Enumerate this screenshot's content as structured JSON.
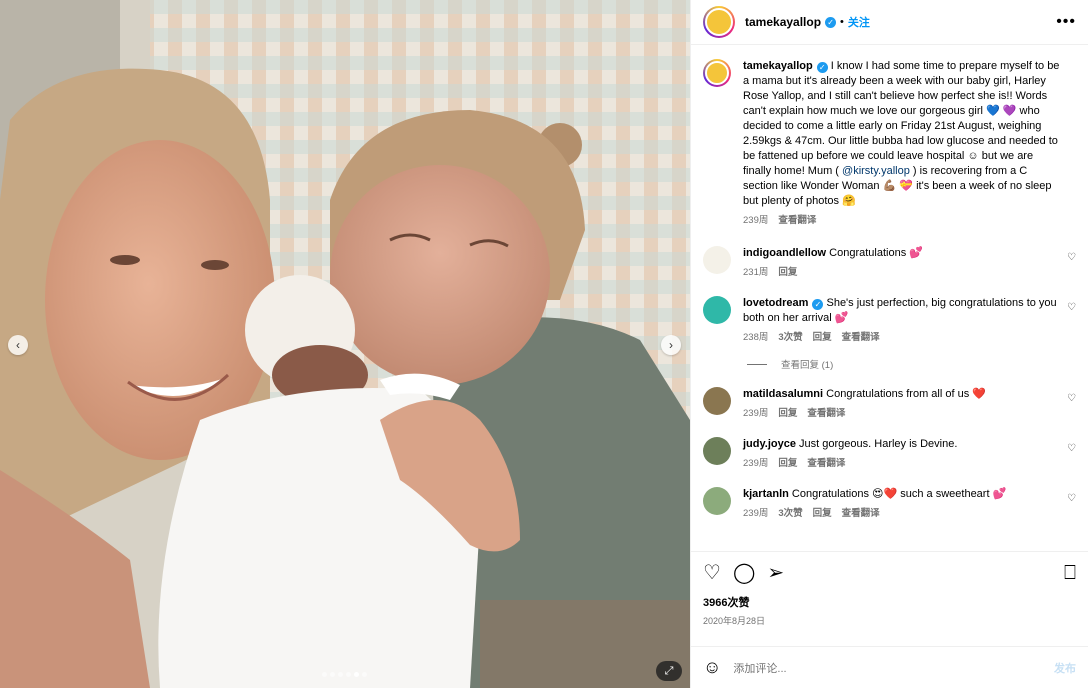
{
  "post": {
    "author": "tamekayallop",
    "follow_label": "关注",
    "separator": "•",
    "more_label": "•••",
    "caption": {
      "username": "tamekayallop",
      "text_1": "I know I had some time to prepare myself to be a mama but it's already been a week with our baby girl, Harley Rose Yallop, and I still can't believe how perfect she is!! Words can't explain how much we love our gorgeous girl 💙 💜 who decided to come a little early on Friday 21st August, weighing 2.59kgs & 47cm. Our little bubba had low glucose and needed to be fattened up before we could leave hospital ☺ but we are finally home! Mum ( ",
      "mention": "@kirsty.yallop",
      "text_2": " ) is recovering from a C section like Wonder Woman 💪🏽 💝 it's been a week of no sleep but plenty of photos 🤗",
      "time": "239周",
      "translate": "查看翻译"
    },
    "comments": [
      {
        "username": "indigoandlellow",
        "verified": false,
        "text": "Congratulations 💕",
        "time": "231周",
        "likes": "",
        "reply": "回复",
        "translate": "",
        "avatar_color": "#f4f1e8"
      },
      {
        "username": "lovetodream",
        "verified": true,
        "text": "She's just perfection, big congratulations to you both on her arrival 💕",
        "time": "238周",
        "likes": "3次赞",
        "reply": "回复",
        "translate": "查看翻译",
        "avatar_color": "#2fb8a8"
      },
      {
        "username": "matildasalumni",
        "verified": false,
        "text": "Congratulations from all of us ❤️",
        "time": "239周",
        "likes": "",
        "reply": "回复",
        "translate": "查看翻译",
        "avatar_color": "#8a7650"
      },
      {
        "username": "judy.joyce",
        "verified": false,
        "text": "Just gorgeous. Harley is Devine.",
        "time": "239周",
        "likes": "",
        "reply": "回复",
        "translate": "查看翻译",
        "avatar_color": "#6d7f5a"
      },
      {
        "username": "kjartanln",
        "verified": false,
        "text": "Congratulations 😍❤️ such a sweetheart 💕",
        "time": "239周",
        "likes": "3次赞",
        "reply": "回复",
        "translate": "查看翻译",
        "avatar_color": "#8cab7c"
      }
    ],
    "view_replies": "查看回复 (1)",
    "likes": "3966次赞",
    "date": "2020年8月28日",
    "add_comment_placeholder": "添加评论...",
    "post_button": "发布",
    "carousel": {
      "count": 6,
      "active_index": 4
    }
  },
  "icons": {
    "like": "heart-icon",
    "comment": "comment-icon",
    "share": "share-icon",
    "save": "bookmark-icon",
    "emoji": "emoji-icon",
    "prev": "chevron-left-icon",
    "next": "chevron-right-icon"
  },
  "colors": {
    "link_blue": "#0095f6",
    "verified_blue": "#1d9bf0",
    "meta_gray": "#737373"
  }
}
